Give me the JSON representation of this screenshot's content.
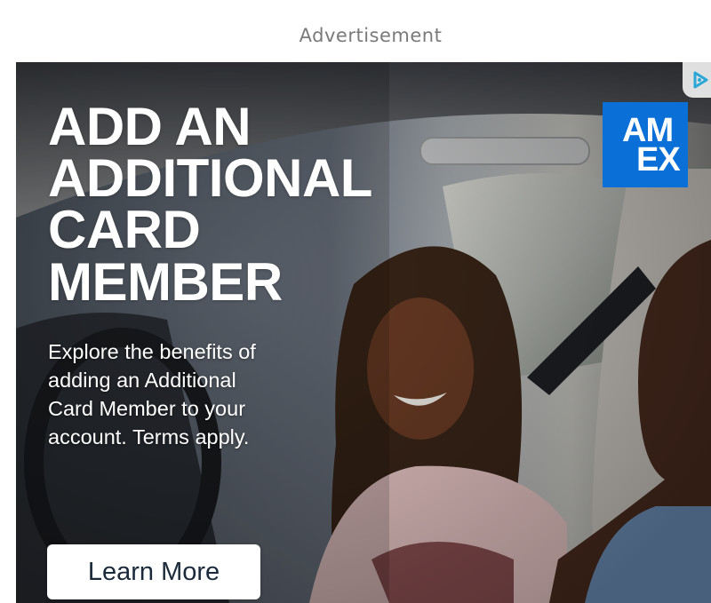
{
  "ad_label": "Advertisement",
  "ad": {
    "headline": [
      "ADD AN",
      "ADDITIONAL",
      "CARD",
      "MEMBER"
    ],
    "body": [
      "Explore the benefits of",
      "adding an Additional",
      "Card Member to your",
      "account. Terms apply."
    ],
    "cta_label": "Learn More",
    "logo": {
      "line1": "AM",
      "line2": "EX",
      "icon": "amex-logo",
      "color": "#0A6FD6"
    },
    "adchoices_icon": "adchoices-icon"
  },
  "colors": {
    "text_white": "#FFFFFF",
    "cta_bg": "#FFFFFF",
    "cta_text": "#1B2A3A",
    "label_gray": "#7A7A7A"
  }
}
